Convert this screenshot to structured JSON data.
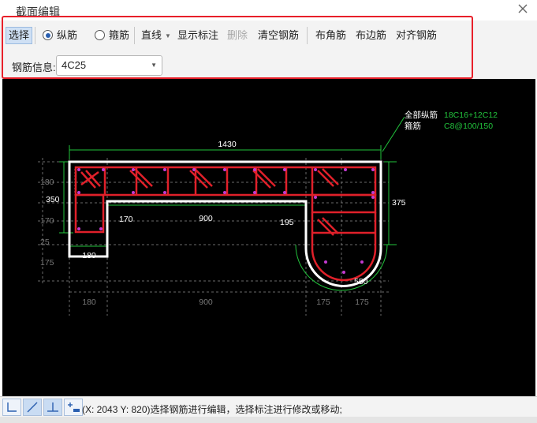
{
  "window": {
    "title": "截面编辑",
    "close_icon": "close-icon"
  },
  "toolbar": {
    "select": "选择",
    "longitudinal": "纵筋",
    "stirrup": "箍筋",
    "line": "直线",
    "show_dim": "显示标注",
    "delete": "删除",
    "clear_rebar": "清空钢筋",
    "corner_rebar": "布角筋",
    "edge_rebar": "布边筋",
    "align_rebar": "对齐钢筋",
    "selected_radio": "纵筋"
  },
  "rebar_info": {
    "label": "钢筋信息:",
    "value": "4C25"
  },
  "drawing": {
    "legend": {
      "all_long_label": "全部纵筋",
      "all_long_value": "18C16+12C12",
      "stirrup_label": "箍筋",
      "stirrup_value": "C8@100/150"
    },
    "dims": {
      "top_width": "1430",
      "left_height": "350",
      "right_height": "375",
      "flange_left": "170",
      "opening": "900",
      "flange_right": "195",
      "bottom_left": "180",
      "radius": "550",
      "axis_left_1": "180",
      "axis_left_2": "170",
      "axis_left_3": "25",
      "axis_left_4": "175",
      "axis_left_top": "180",
      "axis_bottom_1": "180",
      "axis_bottom_2": "900",
      "axis_bottom_3": "175",
      "axis_bottom_4": "175"
    }
  },
  "status": {
    "text": "(X: 2043 Y: 820)选择钢筋进行编辑，选择标注进行修改或移动;"
  },
  "colors": {
    "accent": "#e8202a",
    "rebar": "#e0202a",
    "dim": "#22c33c",
    "outline": "#ffffff",
    "dot": "#c33ad0"
  }
}
